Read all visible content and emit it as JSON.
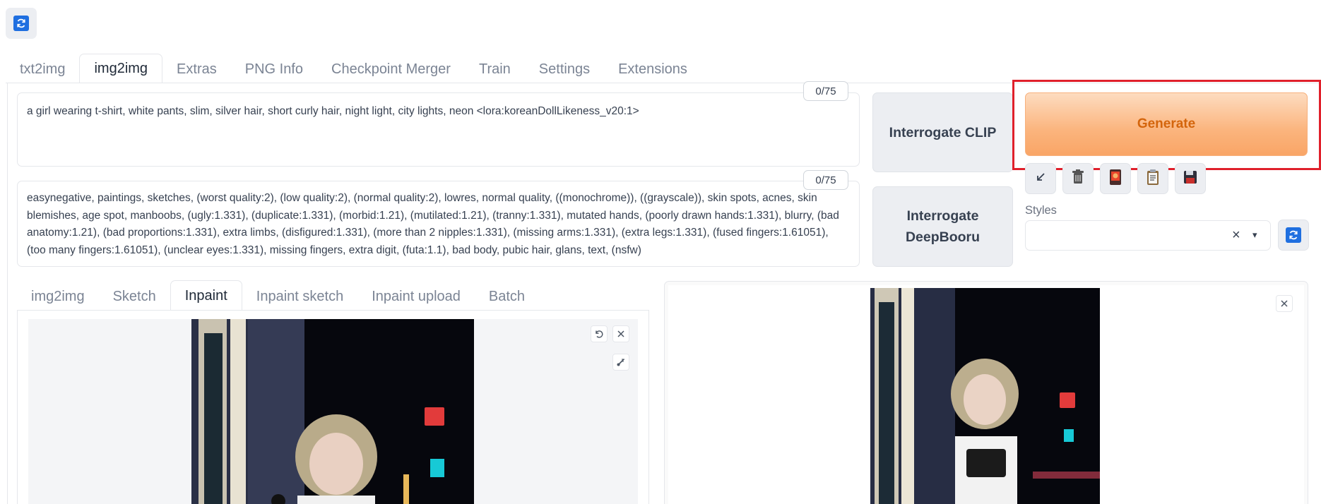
{
  "main_tabs": [
    "txt2img",
    "img2img",
    "Extras",
    "PNG Info",
    "Checkpoint Merger",
    "Train",
    "Settings",
    "Extensions"
  ],
  "active_main_tab": "img2img",
  "prompt": {
    "text": "a girl wearing t-shirt, white pants, slim, silver hair, short curly hair, night light, city lights, neon <lora:koreanDollLikeness_v20:1>",
    "token_count": "0/75"
  },
  "negative_prompt": {
    "text": "easynegative, paintings, sketches, (worst quality:2), (low quality:2), (normal quality:2), lowres, normal quality, ((monochrome)), ((grayscale)), skin spots, acnes, skin blemishes, age spot, manboobs, (ugly:1.331), (duplicate:1.331), (morbid:1.21), (mutilated:1.21), (tranny:1.331), mutated hands, (poorly drawn hands:1.331), blurry, (bad anatomy:1.21), (bad proportions:1.331), extra limbs, (disfigured:1.331), (more than 2 nipples:1.331), (missing arms:1.331), (extra legs:1.331), (fused fingers:1.61051), (too many fingers:1.61051), (unclear eyes:1.331), missing fingers, extra digit, (futa:1.1), bad body, pubic hair, glans, text, (nsfw)",
    "token_count": "0/75"
  },
  "buttons": {
    "interrogate_clip": "Interrogate CLIP",
    "interrogate_deepbooru_line1": "Interrogate",
    "interrogate_deepbooru_line2": "DeepBooru",
    "generate": "Generate"
  },
  "tool_icons": [
    "arrow-icon",
    "trash-icon",
    "card-icon",
    "clipboard-icon",
    "save-icon"
  ],
  "styles": {
    "label": "Styles",
    "value": "",
    "clear_glyph": "×",
    "caret_glyph": "▾"
  },
  "sub_tabs": [
    "img2img",
    "Sketch",
    "Inpaint",
    "Inpaint sketch",
    "Inpaint upload",
    "Batch"
  ],
  "active_sub_tab": "Inpaint",
  "colors": {
    "accent_orange": "#fbb47d",
    "generate_text": "#d4650c",
    "highlight_red": "#e0202b",
    "refresh_blue": "#1f6fe0"
  }
}
